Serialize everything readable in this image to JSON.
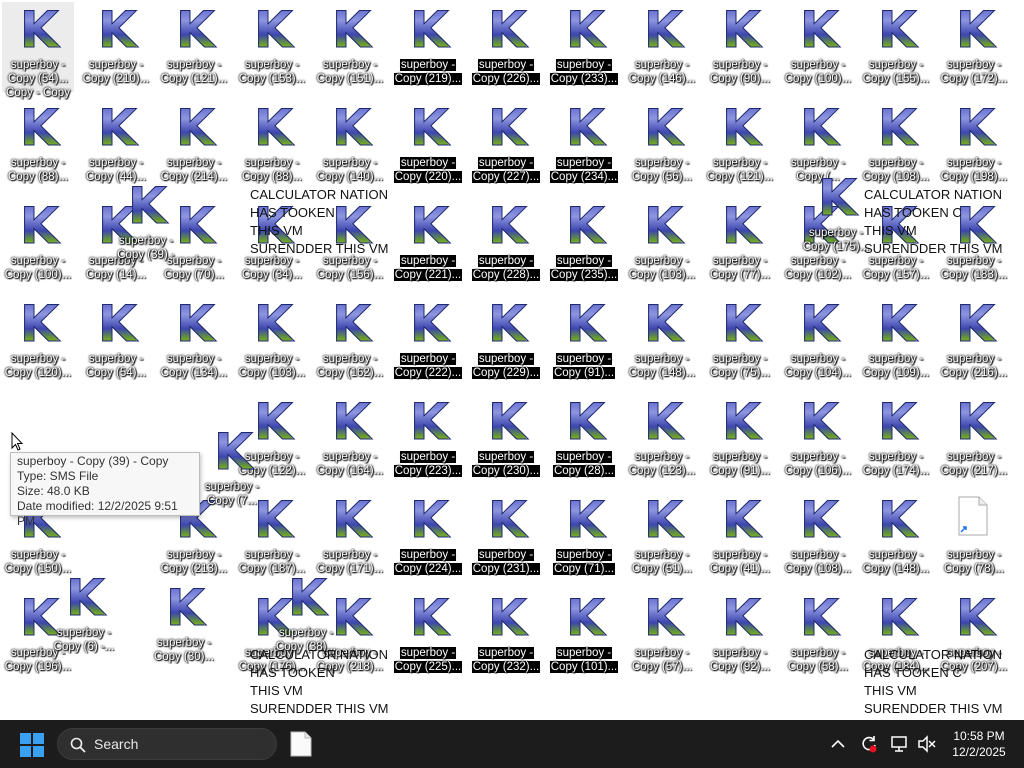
{
  "desktop": {
    "rows": [
      [
        "Copy (54)...",
        "Copy (210)...",
        "Copy (121)...",
        "Copy (153)...",
        "Copy (151)...",
        "Copy (219)...",
        "Copy (226)...",
        "Copy (233)...",
        "Copy (146)...",
        "Copy (90)...",
        "Copy (100)...",
        "Copy (155)...",
        "Copy (172)..."
      ],
      [
        "Copy (88)...",
        "Copy (44)...",
        "Copy (214)...",
        "Copy (88)...",
        "Copy (140)...",
        "Copy (220)...",
        "Copy (227)...",
        "Copy (234)...",
        "Copy (56)...",
        "Copy (121)...",
        "Copy (...",
        "Copy (108)...",
        "Copy (198)..."
      ],
      [
        "Copy (100)...",
        "Copy (14)...",
        "Copy (70)...",
        "Copy (34)...",
        "Copy (156)...",
        "Copy (221)...",
        "Copy (228)...",
        "Copy (235)...",
        "Copy (103)...",
        "Copy (77)...",
        "Copy (102)...",
        "Copy (157)...",
        "Copy (183)..."
      ],
      [
        "Copy (120)...",
        "Copy (54)...",
        "Copy (134)...",
        "Copy (103)...",
        "Copy (162)...",
        "Copy (222)...",
        "Copy (229)...",
        "Copy (91)...",
        "Copy (148)...",
        "Copy (75)...",
        "Copy (104)...",
        "Copy (109)...",
        "Copy (216)..."
      ],
      [
        "",
        "",
        "",
        "Copy (122)...",
        "Copy (164)...",
        "Copy (223)...",
        "Copy (230)...",
        "Copy (28)...",
        "Copy (123)...",
        "Copy (91)...",
        "Copy (106)...",
        "Copy (174)...",
        "Copy (217)..."
      ],
      [
        "Copy (150)...",
        "",
        "Copy (213)...",
        "Copy (187)...",
        "Copy (171)...",
        "Copy (224)...",
        "Copy (231)...",
        "Copy (71)...",
        "Copy (51)...",
        "Copy (41)...",
        "Copy (108)...",
        "Copy (148)...",
        "Copy (78)..."
      ],
      [
        "Copy (196)...",
        "",
        "",
        "Copy (176)...",
        "Copy (218)...",
        "Copy (225)...",
        "Copy (232)...",
        "Copy (101)...",
        "Copy (57)...",
        "Copy (92)...",
        "Copy (58)...",
        "Copy (184)...",
        "Copy (207)..."
      ]
    ],
    "name_prefix": "superboy -",
    "icon_letter": "K",
    "first_icon_extra": "Copy - Copy",
    "overlay_notes": {
      "left_top": "CALCULATOR NATION\nHAS TOOKEN\nTHIS VM\nSURENDDER THIS VM",
      "right_top": "CALCULATOR NATION\nHAS TOOKEN C\nTHIS VM\nSURENDDER THIS VM",
      "left_bottom": "CALCULATOR NATION\nHAS TOOKEN\nTHIS VM\nSURENDDER THIS VM",
      "right_bottom": "CALCULATOR NATION\nHAS TOOKEN C\nTHIS VM\nSURENDDER THIS VM"
    },
    "floating": [
      {
        "label": "superboy -",
        "sub": "Copy (39) -"
      },
      {
        "label": "superboy -",
        "sub": "Copy (7..."
      },
      {
        "label": "superboy -",
        "sub": "Copy (6) -..."
      },
      {
        "label": "superboy -",
        "sub": "Copy (30)..."
      },
      {
        "label": "superboy -",
        "sub": "Copy (38)..."
      },
      {
        "label": "superboy -",
        "sub": "Copy (175)..."
      }
    ]
  },
  "tooltip": {
    "name": "superboy - Copy (39) - Copy",
    "type": "Type: SMS File",
    "size": "Size: 48.0 KB",
    "modified": "Date modified: 12/2/2025 9:51 PM"
  },
  "taskbar": {
    "search_label": "Search",
    "time": "10:58 PM",
    "date": "12/2/2025"
  }
}
